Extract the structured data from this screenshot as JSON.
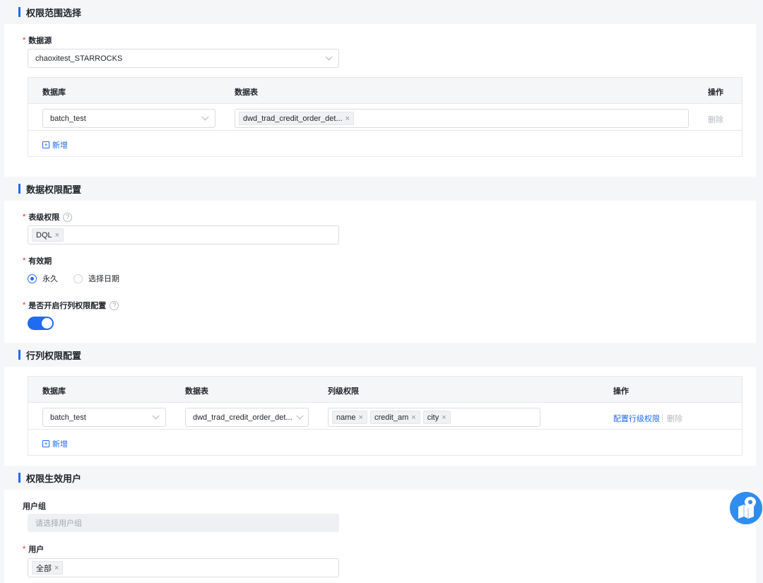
{
  "sections": {
    "scope": "权限范围选择",
    "data_perm": "数据权限配置",
    "row_col": "行列权限配置",
    "users": "权限生效用户"
  },
  "scope": {
    "datasource_label": "数据源",
    "datasource_value": "chaoxitest_STARROCKS",
    "table": {
      "col_db": "数据库",
      "col_table": "数据表",
      "col_action": "操作",
      "rows": [
        {
          "db": "batch_test",
          "table_tag": "dwd_trad_credit_order_det...",
          "action": "删除"
        }
      ],
      "add": "新增"
    }
  },
  "data_perm": {
    "table_level_label": "表级权限",
    "table_level_tags": [
      "DQL"
    ],
    "validity_label": "有效期",
    "validity_options": [
      "永久",
      "选择日期"
    ],
    "validity_selected": "永久",
    "rowcol_toggle_label": "是否开启行列权限配置",
    "rowcol_toggle_on": true
  },
  "row_col": {
    "col_db": "数据库",
    "col_table": "数据表",
    "col_col_perm": "列级权限",
    "col_action": "操作",
    "rows": [
      {
        "db": "batch_test",
        "table": "dwd_trad_credit_order_det...",
        "columns": [
          "name",
          "credit_am",
          "city"
        ],
        "config": "配置行级权限",
        "delete": "删除"
      }
    ],
    "add": "新增"
  },
  "users": {
    "group_label": "用户组",
    "group_placeholder": "请选择用户组",
    "user_label": "用户",
    "user_tags": [
      "全部"
    ]
  },
  "glyphs": {
    "close": "×",
    "plus": "+",
    "help": "?"
  },
  "colors": {
    "accent": "#1f6bf2",
    "required": "#f5222d"
  }
}
